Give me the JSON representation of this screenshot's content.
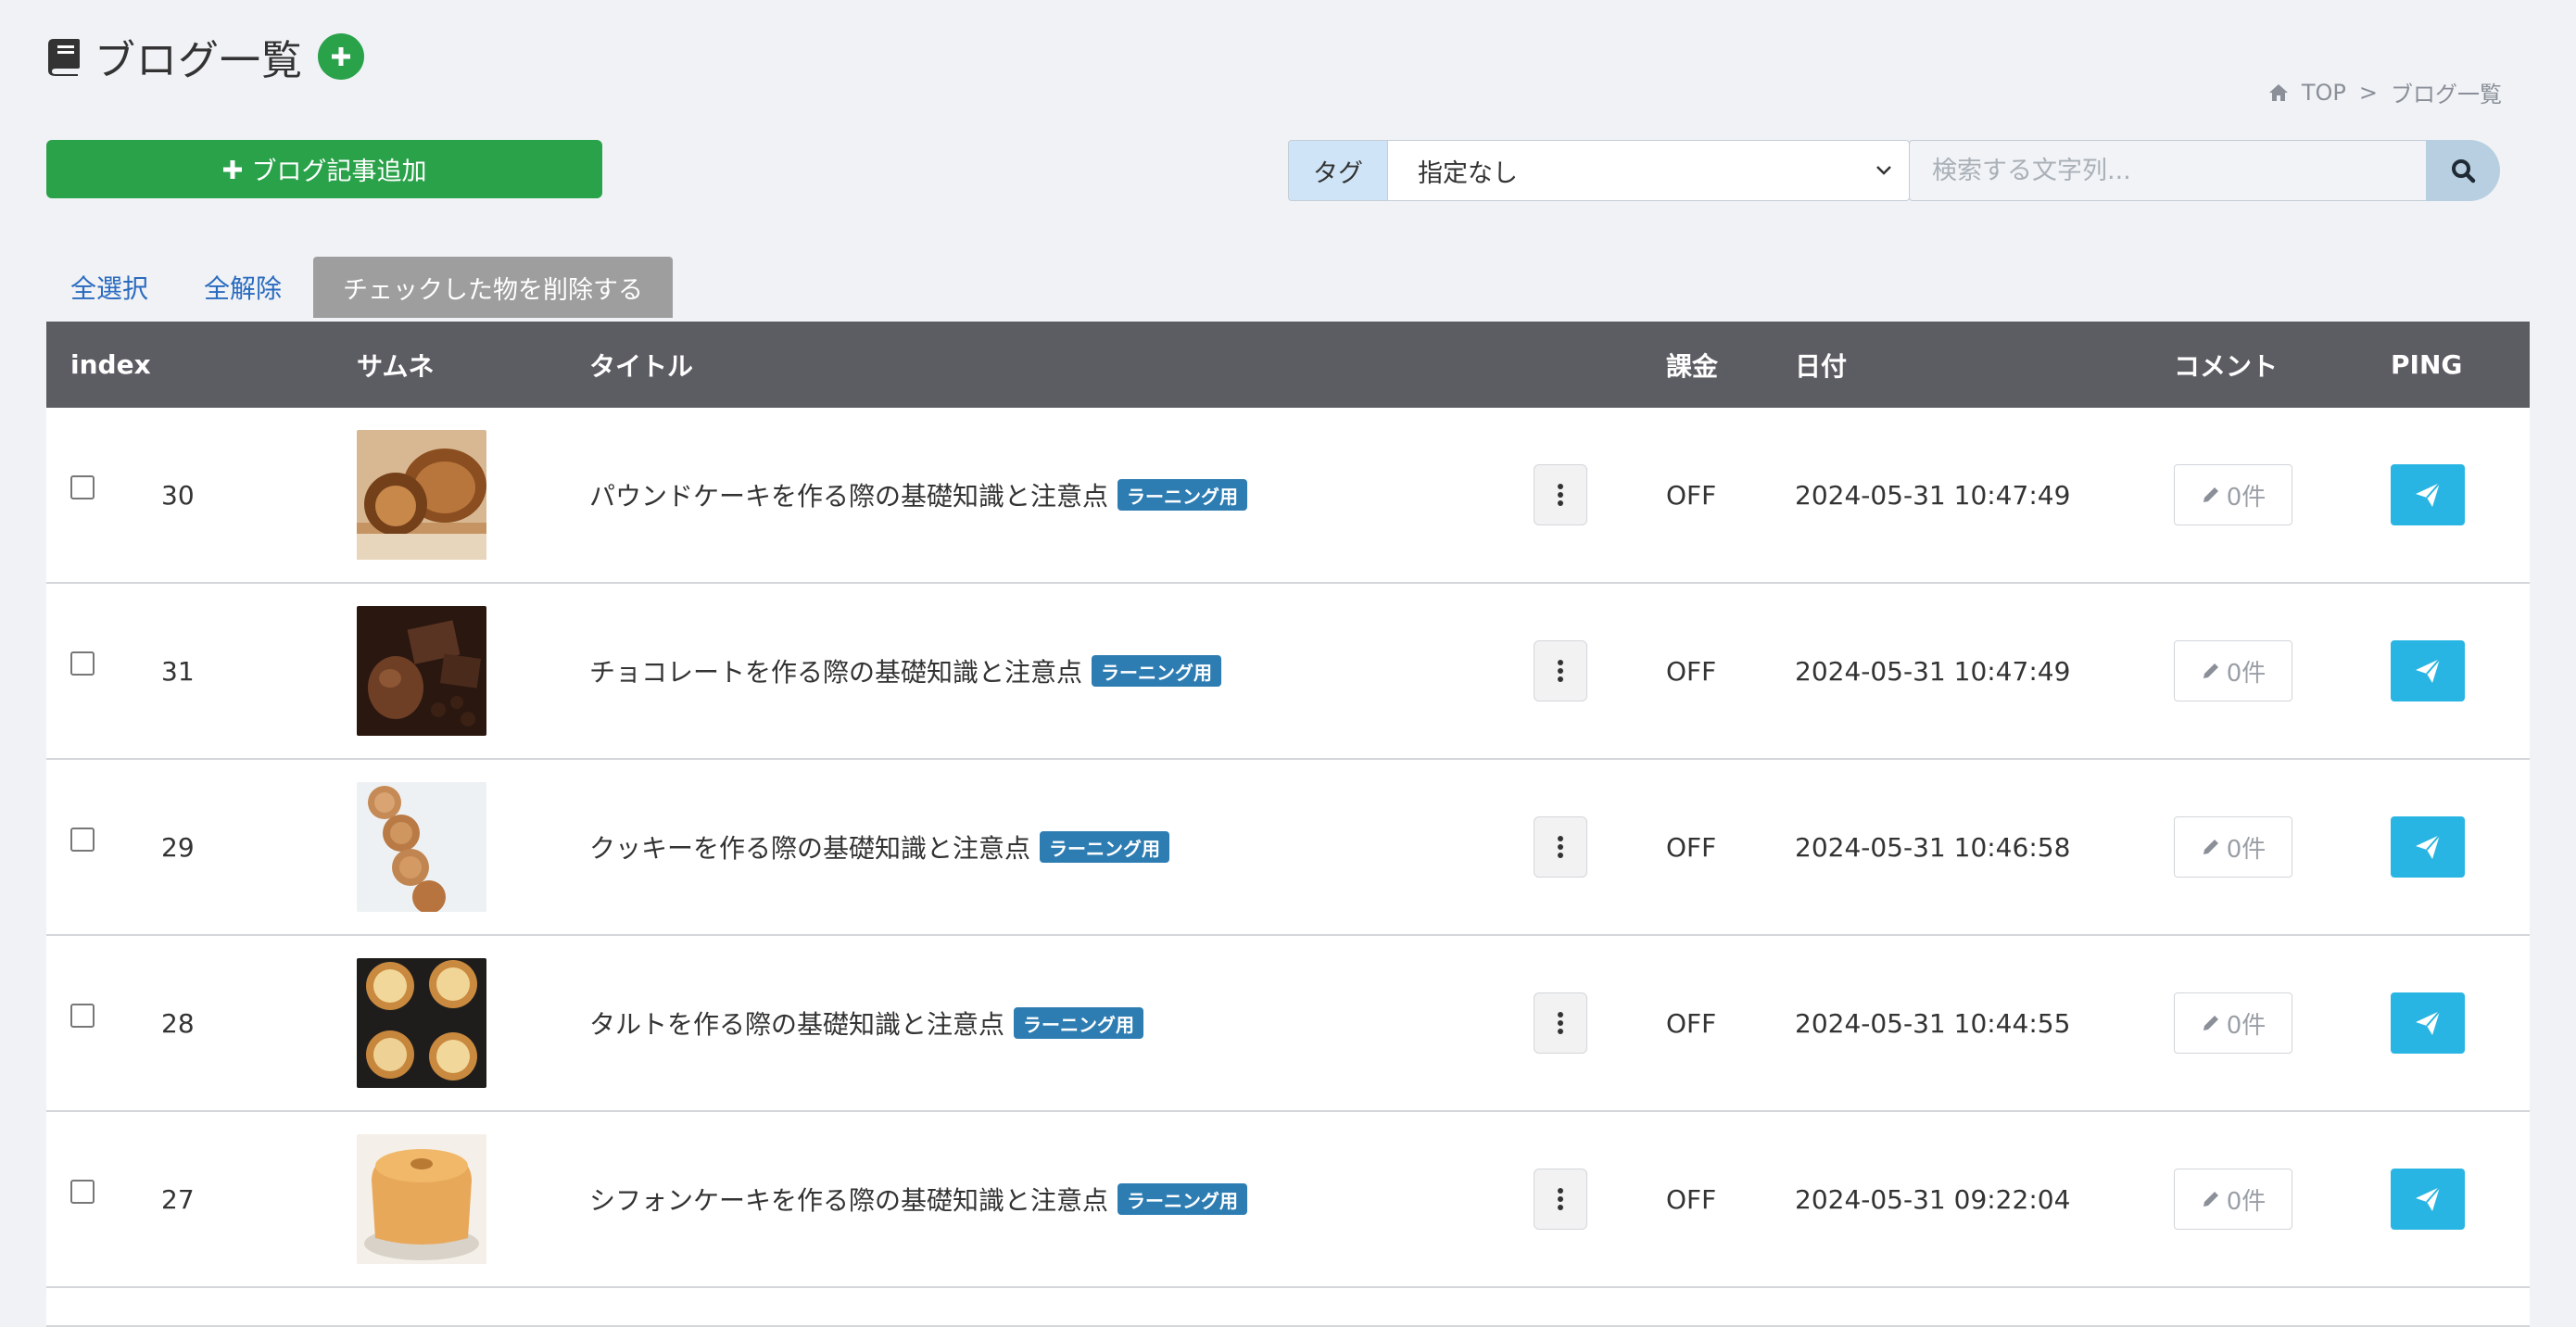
{
  "header": {
    "title": "ブログ一覧",
    "breadcrumb": [
      {
        "label": "TOP"
      },
      {
        "label": "ブログ一覧"
      }
    ],
    "breadcrumb_sep": ">"
  },
  "toolbar": {
    "add_label": "ブログ記事追加",
    "tag_label": "タグ",
    "tag_selected": "指定なし",
    "search_placeholder": "検索する文字列..."
  },
  "bulk": {
    "select_all": "全選択",
    "deselect_all": "全解除",
    "delete_checked": "チェックした物を削除する"
  },
  "table": {
    "columns": {
      "index": "index",
      "thumb": "サムネ",
      "title": "タイトル",
      "billing": "課金",
      "date": "日付",
      "comment": "コメント",
      "ping": "PING"
    },
    "rows": [
      {
        "index": "30",
        "title": "パウンドケーキを作る際の基礎知識と注意点",
        "tag": "ラーニング用",
        "billing": "OFF",
        "date": "2024-05-31 10:47:49",
        "comments": "0件"
      },
      {
        "index": "31",
        "title": "チョコレートを作る際の基礎知識と注意点",
        "tag": "ラーニング用",
        "billing": "OFF",
        "date": "2024-05-31 10:47:49",
        "comments": "0件"
      },
      {
        "index": "29",
        "title": "クッキーを作る際の基礎知識と注意点",
        "tag": "ラーニング用",
        "billing": "OFF",
        "date": "2024-05-31 10:46:58",
        "comments": "0件"
      },
      {
        "index": "28",
        "title": "タルトを作る際の基礎知識と注意点",
        "tag": "ラーニング用",
        "billing": "OFF",
        "date": "2024-05-31 10:44:55",
        "comments": "0件"
      },
      {
        "index": "27",
        "title": "シフォンケーキを作る際の基礎知識と注意点",
        "tag": "ラーニング用",
        "billing": "OFF",
        "date": "2024-05-31 09:22:04",
        "comments": "0件"
      }
    ]
  },
  "colors": {
    "green": "#2aa24a",
    "header_bg": "#5c5c63",
    "badge": "#2d7db3",
    "ping": "#29b5e3",
    "link": "#2a6bbf"
  },
  "icons": {
    "title": "book-icon",
    "home": "home-icon",
    "search": "search-icon",
    "more": "ellipsis-vertical-icon",
    "comment": "pencil-icon",
    "ping": "paper-plane-icon"
  }
}
